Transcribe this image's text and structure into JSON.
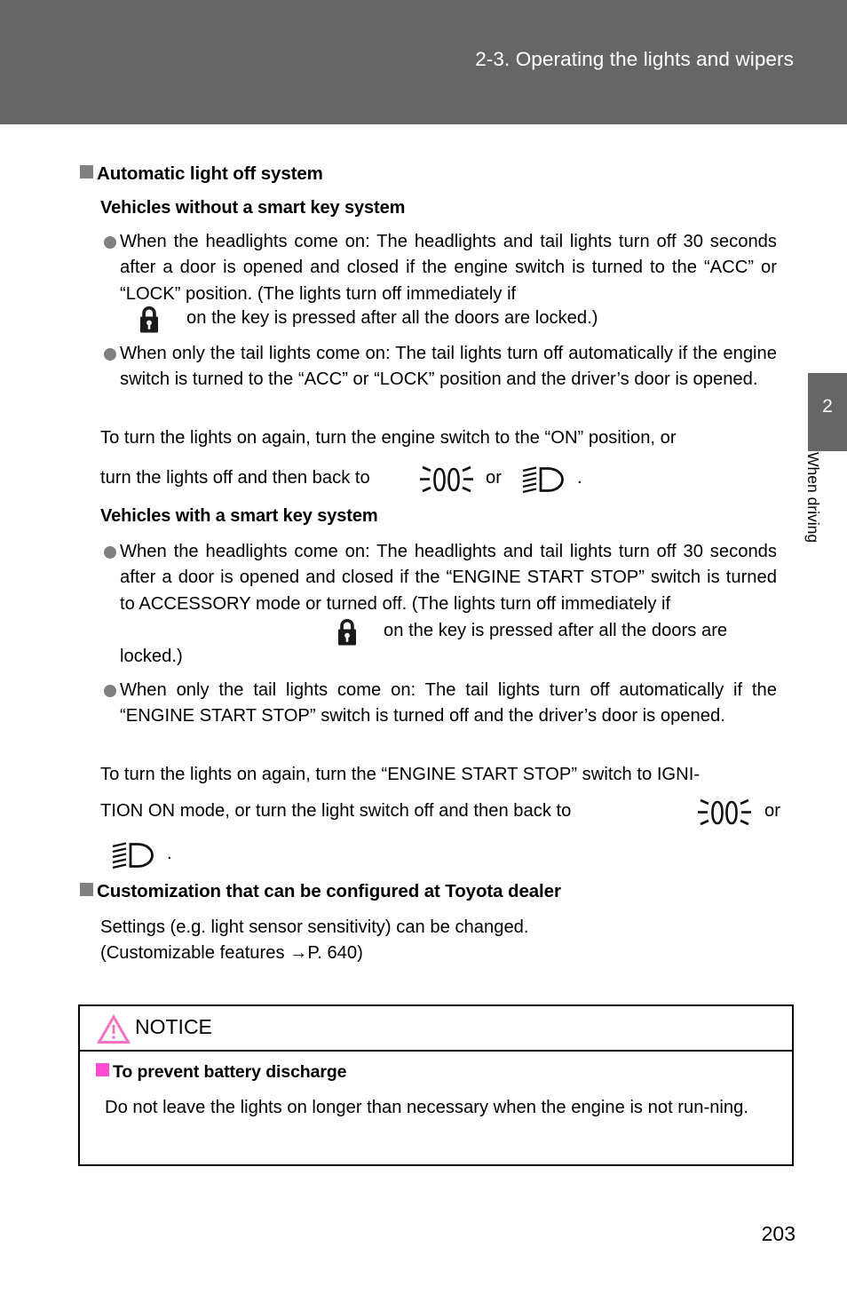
{
  "header": {
    "title": "2-3. Operating the lights and wipers"
  },
  "side_tab": {
    "number": "2",
    "label": "When driving"
  },
  "sections": {
    "auto_light_off": {
      "heading": "Automatic light off system",
      "without_smart_key": {
        "subheading": "Vehicles without a smart key system",
        "bullet1_part1": "When the headlights come on: The headlights and tail lights turn off 30 seconds after a door is opened and closed if the engine switch is turned to the “ACC” or “LOCK” position. (The lights turn off immediately if",
        "bullet1_part2": "on the key is pressed after all the doors are locked.)",
        "bullet2": "When only the tail lights come on: The tail lights turn off automatically if the engine switch is turned to the “ACC” or “LOCK” position and the driver’s door is opened.",
        "closing_line1": "To turn the lights on again, turn the engine switch to the “ON” position, or",
        "closing_line2a": "turn the lights off and then back to",
        "closing_or": "or",
        "closing_period": "."
      },
      "with_smart_key": {
        "subheading": "Vehicles with a smart key system",
        "bullet1_part1": "When the headlights come on: The headlights and tail lights turn off 30 seconds after a door is opened and closed if the “ENGINE START STOP” switch is turned to ACCESSORY mode or turned off. (The lights turn off immediately if",
        "bullet1_part2": "on the key is pressed after all the doors are",
        "bullet1_part3": "locked.)",
        "bullet2": "When only the tail lights come on: The tail lights turn off automatically if the “ENGINE START STOP” switch is turned off and the driver’s door is opened.",
        "closing_line1": "To turn the lights on again, turn the “ENGINE START STOP” switch to IGNI-",
        "closing_line2a": "TION ON mode, or turn the light switch off and then back to",
        "closing_or": "or",
        "closing_period": "."
      }
    },
    "customization": {
      "heading": "Customization that can be configured at Toyota dealer",
      "line1": "Settings (e.g. light sensor sensitivity) can be changed.",
      "line2": "(Customizable features →P. 640)"
    }
  },
  "notice": {
    "title": "NOTICE",
    "subheading": "To prevent battery discharge",
    "body": "Do not leave the lights on longer than necessary when the engine is not run-ning."
  },
  "page_number": "203",
  "icons": {
    "lock": "lock-icon",
    "parking_lights": "parking-light-symbol-icon",
    "headlights": "headlight-symbol-icon",
    "warning_triangle": "warning-triangle-icon"
  },
  "colors": {
    "header_gray": "#666666",
    "bullet_gray": "#808080",
    "notice_pink": "#FF4DD2",
    "warning_pink": "#F472C0"
  }
}
